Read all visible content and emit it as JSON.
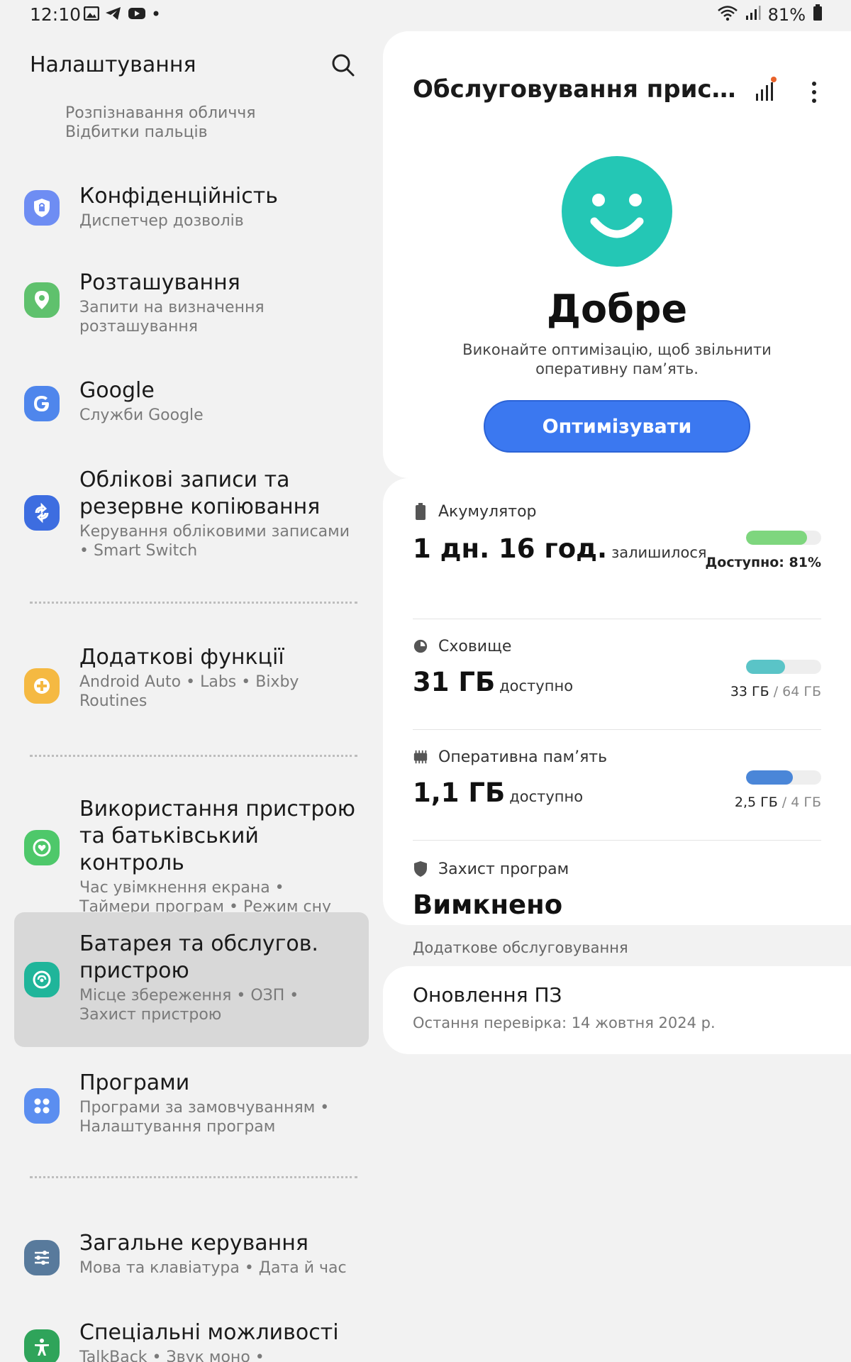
{
  "status_bar": {
    "time": "12:10",
    "battery_percent": "81%",
    "left_icons": [
      "gallery-icon",
      "telegram-icon",
      "youtube-icon",
      "dot-icon"
    ],
    "right_icons": [
      "wifi-icon",
      "signal-icon",
      "battery-icon"
    ]
  },
  "settings": {
    "title": "Налаштування",
    "partial_item": {
      "subtitle_line1": "Розпізнавання обличчя",
      "subtitle_line2": "Відбитки пальців"
    },
    "items": [
      {
        "title": "Конфіденційність",
        "subtitle": "Диспетчер дозволів",
        "icon": "shield-lock-icon",
        "color": "#6e8df3"
      },
      {
        "title": "Розташування",
        "subtitle": "Запити на визначення розташування",
        "icon": "location-pin-icon",
        "color": "#5fc16d"
      },
      {
        "title": "Google",
        "subtitle": "Служби Google",
        "icon": "google-icon",
        "color": "#4f86ec"
      },
      {
        "title": "Облікові записи та резервне копіювання",
        "subtitle": "Керування обліковими записами • Smart Switch",
        "icon": "sync-icon",
        "color": "#3d6de0"
      },
      {
        "title": "Додаткові функції",
        "subtitle": "Android Auto • Labs • Bixby Routines",
        "icon": "puzzle-plus-icon",
        "color": "#f5b942"
      },
      {
        "title": "Використання пристрою та батьківський контроль",
        "subtitle": "Час увімкнення екрана • Таймери програм • Режим сну",
        "icon": "wellbeing-icon",
        "color": "#4ec86a"
      },
      {
        "title": "Батарея та обслугов. пристрою",
        "subtitle": "Місце збереження • ОЗП • Захист пристрою",
        "icon": "device-care-icon",
        "color": "#1fb59a"
      },
      {
        "title": "Програми",
        "subtitle": "Програми за замовчуванням • Налаштування програм",
        "icon": "apps-grid-icon",
        "color": "#5b8ef0"
      },
      {
        "title": "Загальне керування",
        "subtitle": "Мова та клавіатура • Дата й час",
        "icon": "sliders-icon",
        "color": "#587a9c"
      },
      {
        "title": "Спеціальні можливості",
        "subtitle": "TalkBack • Звук моно •",
        "icon": "accessibility-icon",
        "color": "#2fa45a"
      }
    ]
  },
  "device_care": {
    "title": "Обслуговування пристро...",
    "status": "Добре",
    "description": "Виконайте оптимізацію, щоб звільнити оперативну пам’ять.",
    "optimize_label": "Оптимізувати",
    "battery": {
      "label": "Акумулятор",
      "value": "1 дн. 16 год.",
      "suffix": "залишилося",
      "available_label": "Доступно: 81%",
      "level": 0.81,
      "color": "#7ed67e"
    },
    "storage": {
      "label": "Сховище",
      "value": "31 ГБ",
      "suffix": "доступно",
      "used": "33 ГБ",
      "total": "/ 64 ГБ",
      "level": 0.52,
      "color": "#5ac4c7"
    },
    "ram": {
      "label": "Оперативна пам’ять",
      "value": "1,1 ГБ",
      "suffix": "доступно",
      "used": "2,5 ГБ",
      "total": "/ 4 ГБ",
      "level": 0.62,
      "color": "#4a86d8"
    },
    "protection": {
      "label": "Захист програм",
      "value": "Вимкнено"
    },
    "extra_label": "Додаткове обслуговування",
    "update": {
      "title": "Оновлення ПЗ",
      "subtitle": "Остання перевірка: 14 жовтня 2024 р."
    },
    "accent_color": "#24c7b5"
  }
}
